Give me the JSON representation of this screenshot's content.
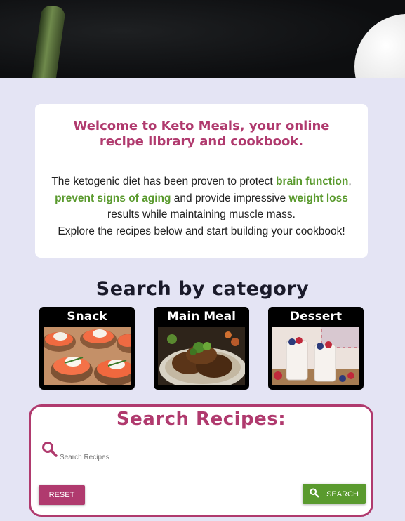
{
  "colors": {
    "accent": "#b03a6e",
    "highlight": "#5a9a2e",
    "page_bg": "#e4e4f4"
  },
  "welcome": {
    "title": "Welcome to Keto Meals, your online recipe library and cookbook.",
    "body_1": "The ketogenic diet has been proven to protect ",
    "link_1": "brain function",
    "body_2": ", ",
    "link_2": "prevent signs of aging",
    "body_3": " and provide impressive ",
    "link_3": "weight loss",
    "body_4": " results while maintaining muscle mass.",
    "body_5": "Explore the recipes below and start building your cookbook!"
  },
  "categories": {
    "heading": "Search by category",
    "items": [
      {
        "label": "Snack",
        "image": "smoked-salmon-canapes"
      },
      {
        "label": "Main Meal",
        "image": "grilled-meat-plate"
      },
      {
        "label": "Dessert",
        "image": "berry-parfait-jars"
      }
    ]
  },
  "search": {
    "title": "Search Recipes:",
    "icon": "search-icon",
    "placeholder": "Search Recipes",
    "reset_label": "Reset",
    "search_label": "Search"
  }
}
